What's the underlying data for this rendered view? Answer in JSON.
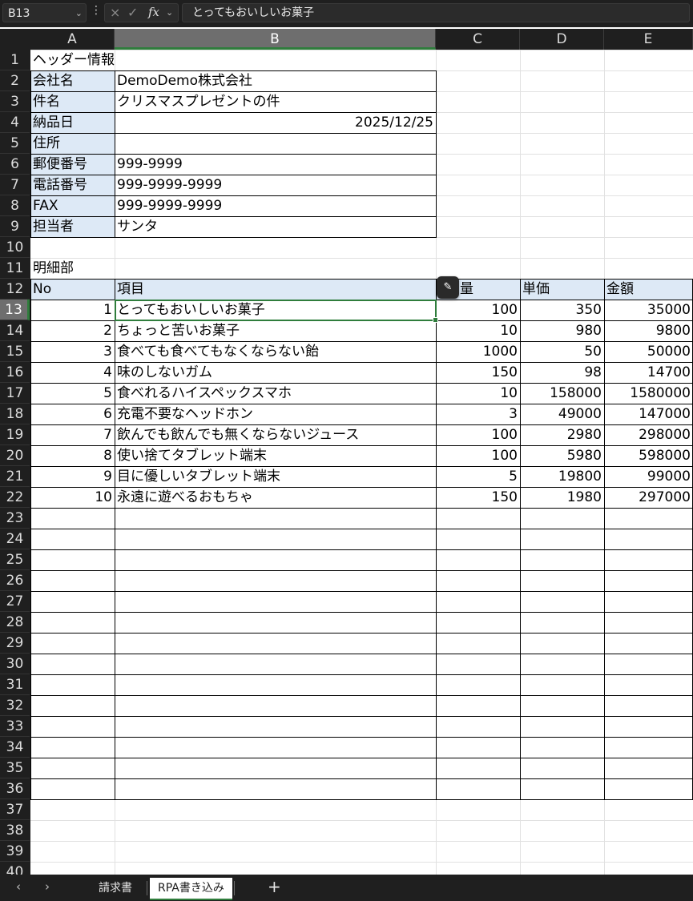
{
  "formula_bar": {
    "name_box": "B13",
    "cancel_icon": "×",
    "enter_icon": "✓",
    "fx_label": "fx",
    "formula": "とってもおいしいお菓子"
  },
  "columns": [
    "A",
    "B",
    "C",
    "D",
    "E"
  ],
  "rows": [
    "1",
    "2",
    "3",
    "4",
    "5",
    "6",
    "7",
    "8",
    "9",
    "10",
    "11",
    "12",
    "13",
    "14",
    "15",
    "16",
    "17",
    "18",
    "19",
    "20",
    "21",
    "22",
    "23",
    "24",
    "25",
    "26",
    "27",
    "28",
    "29",
    "30",
    "31",
    "32",
    "33",
    "34",
    "35",
    "36",
    "37",
    "38",
    "39",
    "40"
  ],
  "header_section": {
    "title": "ヘッダー情報",
    "rows": [
      {
        "label": "会社名",
        "value": "DemoDemo株式会社",
        "align": "left"
      },
      {
        "label": "件名",
        "value": "クリスマスプレゼントの件",
        "align": "left"
      },
      {
        "label": "納品日",
        "value": "2025/12/25",
        "align": "right"
      },
      {
        "label": "住所",
        "value": "",
        "align": "left"
      },
      {
        "label": "郵便番号",
        "value": "999-9999",
        "align": "left"
      },
      {
        "label": "電話番号",
        "value": "999-9999-9999",
        "align": "left"
      },
      {
        "label": "FAX",
        "value": "999-9999-9999",
        "align": "left"
      },
      {
        "label": "担当者",
        "value": "サンタ",
        "align": "left"
      }
    ]
  },
  "detail_section": {
    "title": "明細部",
    "headers": [
      "No",
      "項目",
      "量",
      "単価",
      "金額"
    ],
    "items": [
      {
        "no": "1",
        "item": "とってもおいしいお菓子",
        "qty": "100",
        "price": "350",
        "amount": "35000"
      },
      {
        "no": "2",
        "item": "ちょっと苦いお菓子",
        "qty": "10",
        "price": "980",
        "amount": "9800"
      },
      {
        "no": "3",
        "item": "食べても食べてもなくならない飴",
        "qty": "1000",
        "price": "50",
        "amount": "50000"
      },
      {
        "no": "4",
        "item": "味のしないガム",
        "qty": "150",
        "price": "98",
        "amount": "14700"
      },
      {
        "no": "5",
        "item": "食べれるハイスペックスマホ",
        "qty": "10",
        "price": "158000",
        "amount": "1580000"
      },
      {
        "no": "6",
        "item": "充電不要なヘッドホン",
        "qty": "3",
        "price": "49000",
        "amount": "147000"
      },
      {
        "no": "7",
        "item": "飲んでも飲んでも無くならないジュース",
        "qty": "100",
        "price": "2980",
        "amount": "298000"
      },
      {
        "no": "8",
        "item": "使い捨てタブレット端末",
        "qty": "100",
        "price": "5980",
        "amount": "598000"
      },
      {
        "no": "9",
        "item": "目に優しいタブレット端末",
        "qty": "5",
        "price": "19800",
        "amount": "99000"
      },
      {
        "no": "10",
        "item": "永遠に遊べるおもちゃ",
        "qty": "150",
        "price": "1980",
        "amount": "297000"
      }
    ]
  },
  "sheet_tabs": [
    "請求書",
    "RPA書き込み"
  ],
  "active_tab": "RPA書き込み",
  "selected_cell": "B13",
  "colors": {
    "header_fill": "#dde9f6",
    "selection": "#2f7d3c",
    "chrome": "#1f1f1f"
  }
}
